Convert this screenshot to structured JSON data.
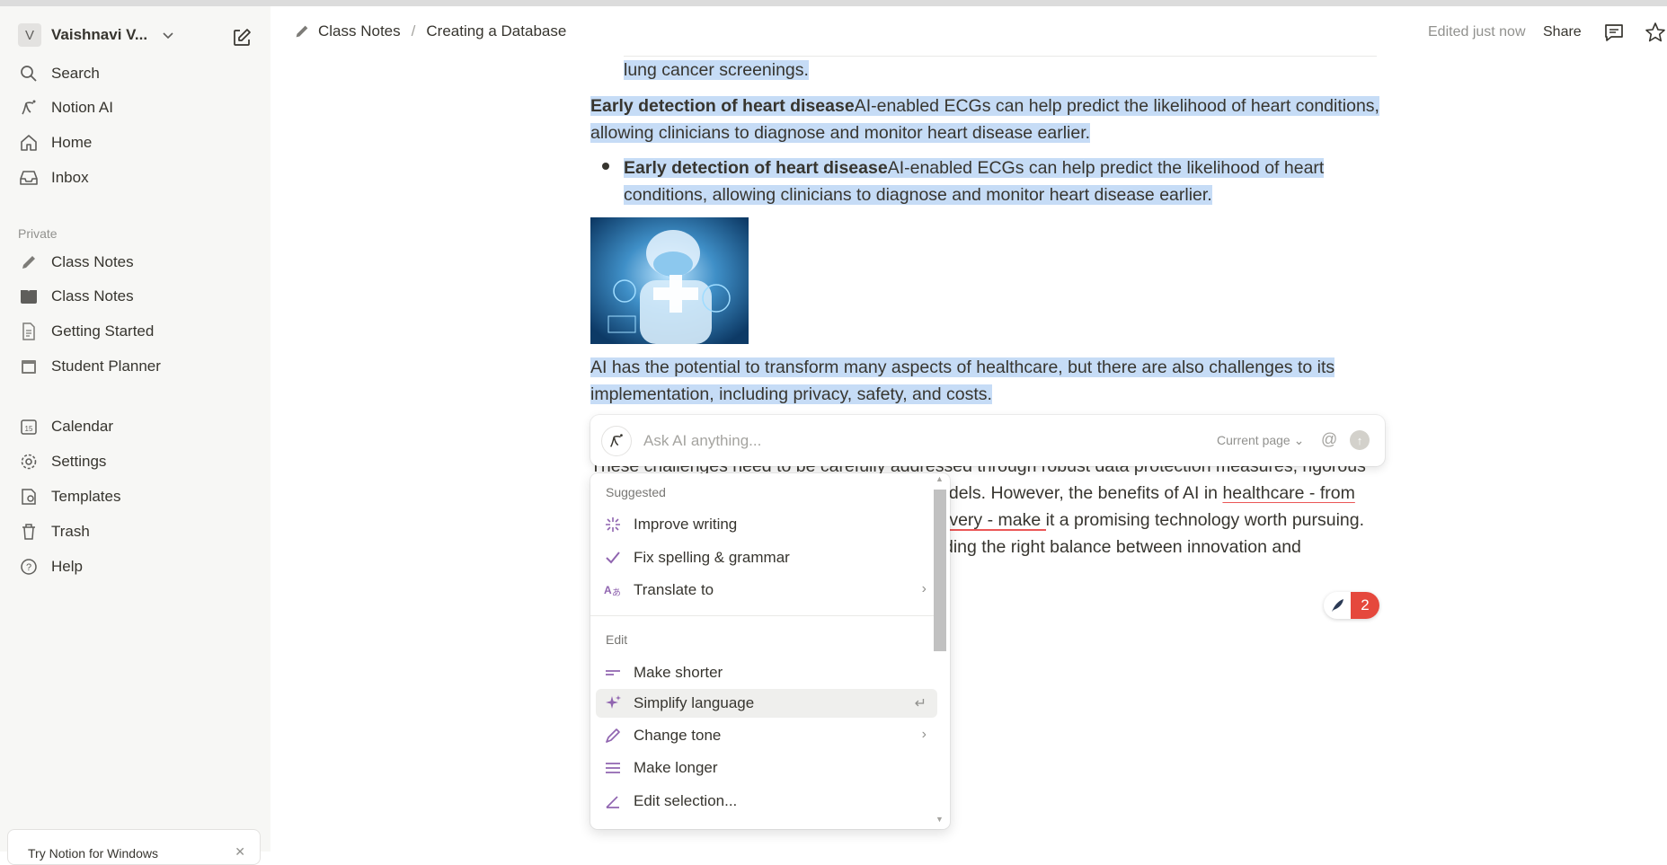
{
  "sidebar": {
    "workspace_initial": "V",
    "workspace_name": "Vaishnavi V...",
    "nav": [
      {
        "label": "Search",
        "icon": "search-icon"
      },
      {
        "label": "Notion AI",
        "icon": "notion-ai-icon"
      },
      {
        "label": "Home",
        "icon": "home-icon"
      },
      {
        "label": "Inbox",
        "icon": "inbox-icon"
      }
    ],
    "private_label": "Private",
    "private_pages": [
      {
        "label": "Class Notes",
        "icon": "pencil-icon"
      },
      {
        "label": "Class Notes",
        "icon": "book-icon"
      },
      {
        "label": "Getting Started",
        "icon": "document-icon"
      },
      {
        "label": "Student Planner",
        "icon": "calendar-page-icon"
      }
    ],
    "bottom": [
      {
        "label": "Calendar",
        "icon": "calendar-icon"
      },
      {
        "label": "Settings",
        "icon": "gear-icon"
      },
      {
        "label": "Templates",
        "icon": "templates-icon"
      },
      {
        "label": "Trash",
        "icon": "trash-icon"
      },
      {
        "label": "Help",
        "icon": "help-icon"
      }
    ],
    "promo_text": "Try Notion for Windows"
  },
  "topbar": {
    "breadcrumb": [
      "Class Notes",
      "Creating a Database"
    ],
    "separator": "/",
    "edited": "Edited just now",
    "share": "Share"
  },
  "content": {
    "line_lung": "lung cancer screenings.",
    "p1_bold": "Early detection of heart disease",
    "p1_line1": "AI-enabled ECGs can help predict the likelihood of heart conditions,",
    "p1_line2": "allowing clinicians to diagnose and monitor heart disease earlier.",
    "b1_bold": "Early detection of heart disease",
    "b1_line1": "AI-enabled ECGs can help predict the likelihood of heart",
    "b1_line2": "conditions, allowing clinicians to diagnose and monitor heart disease earlier.",
    "p2_line1": "AI has the potential to transform many aspects of healthcare, but there are also challenges to its",
    "p2_line2": "implementation, including privacy, safety, and costs.",
    "p3_line1": "These challenges need to be carefully addressed through robust data protection measures, rigorous",
    "p3_line2a": "odels. However, the benefits of AI in ",
    "p3_line2b": "healthcare - from",
    "p3_line3a": "ivery - make",
    "p3_line3b": " it a promising technology worth pursuing.",
    "p3_line4": "ding the right balance between innovation and",
    "comment_count": "2"
  },
  "ai_bar": {
    "placeholder": "Ask AI anything...",
    "scope": "Current page",
    "at_symbol": "@"
  },
  "menu": {
    "suggested_label": "Suggested",
    "suggested": [
      {
        "label": "Improve writing",
        "icon": "sparkle-burst-icon"
      },
      {
        "label": "Fix spelling & grammar",
        "icon": "check-icon"
      },
      {
        "label": "Translate to",
        "icon": "translate-icon"
      }
    ],
    "edit_label": "Edit",
    "edit": [
      {
        "label": "Make shorter",
        "icon": "shorter-lines-icon"
      },
      {
        "label": "Simplify language",
        "icon": "sparkles-icon"
      },
      {
        "label": "Change tone",
        "icon": "pen-icon"
      },
      {
        "label": "Make longer",
        "icon": "longer-lines-icon"
      },
      {
        "label": "Edit selection...",
        "icon": "edit-angle-icon"
      }
    ],
    "enter_hint": "↵",
    "accent": "#9065b0"
  },
  "colors": {
    "selection": "#c6dcf6",
    "badge_red": "#e5483d",
    "sidebar_bg": "#f7f7f5"
  }
}
